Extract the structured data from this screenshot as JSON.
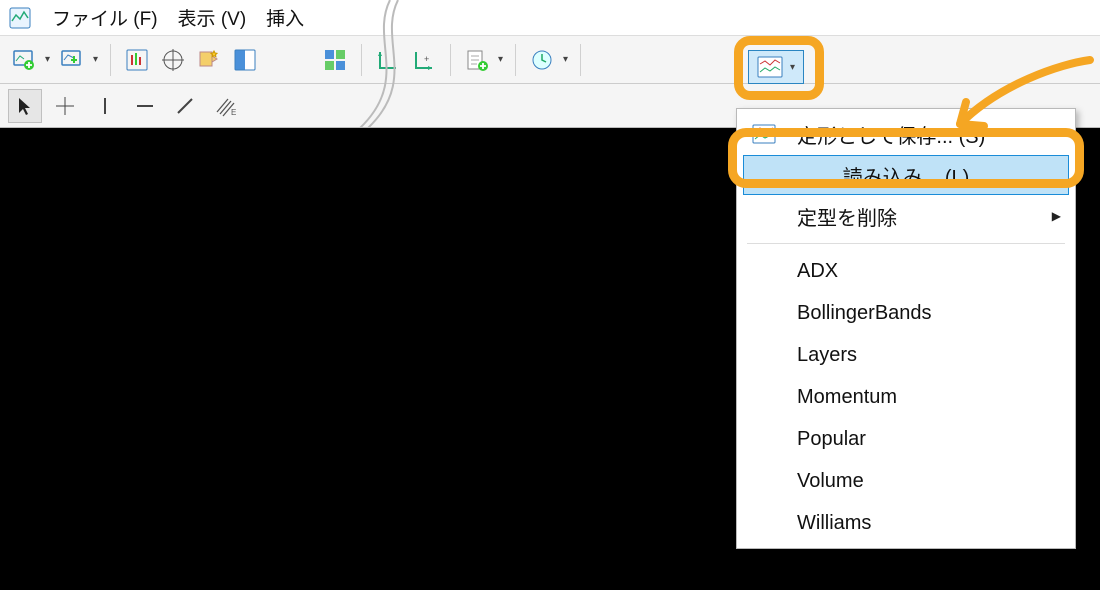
{
  "menubar": {
    "items": [
      "ファイル (F)",
      "表示 (V)",
      "挿入"
    ]
  },
  "toolbar": {
    "buttons": [
      "new-chart",
      "chart-props",
      "sep",
      "chart-type",
      "crosshair",
      "favorites",
      "docked",
      "sep-tear",
      "tile",
      "sep",
      "axis1",
      "axis2",
      "sep",
      "add-indicator",
      "sep",
      "time",
      "sep"
    ]
  },
  "toolbar2": {
    "tools": [
      "cursor",
      "crosshair-tool",
      "vline",
      "hline",
      "trendline",
      "fib"
    ]
  },
  "template_button": {
    "name": "template-dropdown"
  },
  "dropdown": {
    "save_as": "定形として保存... (S)",
    "load": "読み込み... (L)",
    "delete": "定型を削除",
    "templates": [
      "ADX",
      "BollingerBands",
      "Layers",
      "Momentum",
      "Popular",
      "Volume",
      "Williams"
    ]
  }
}
